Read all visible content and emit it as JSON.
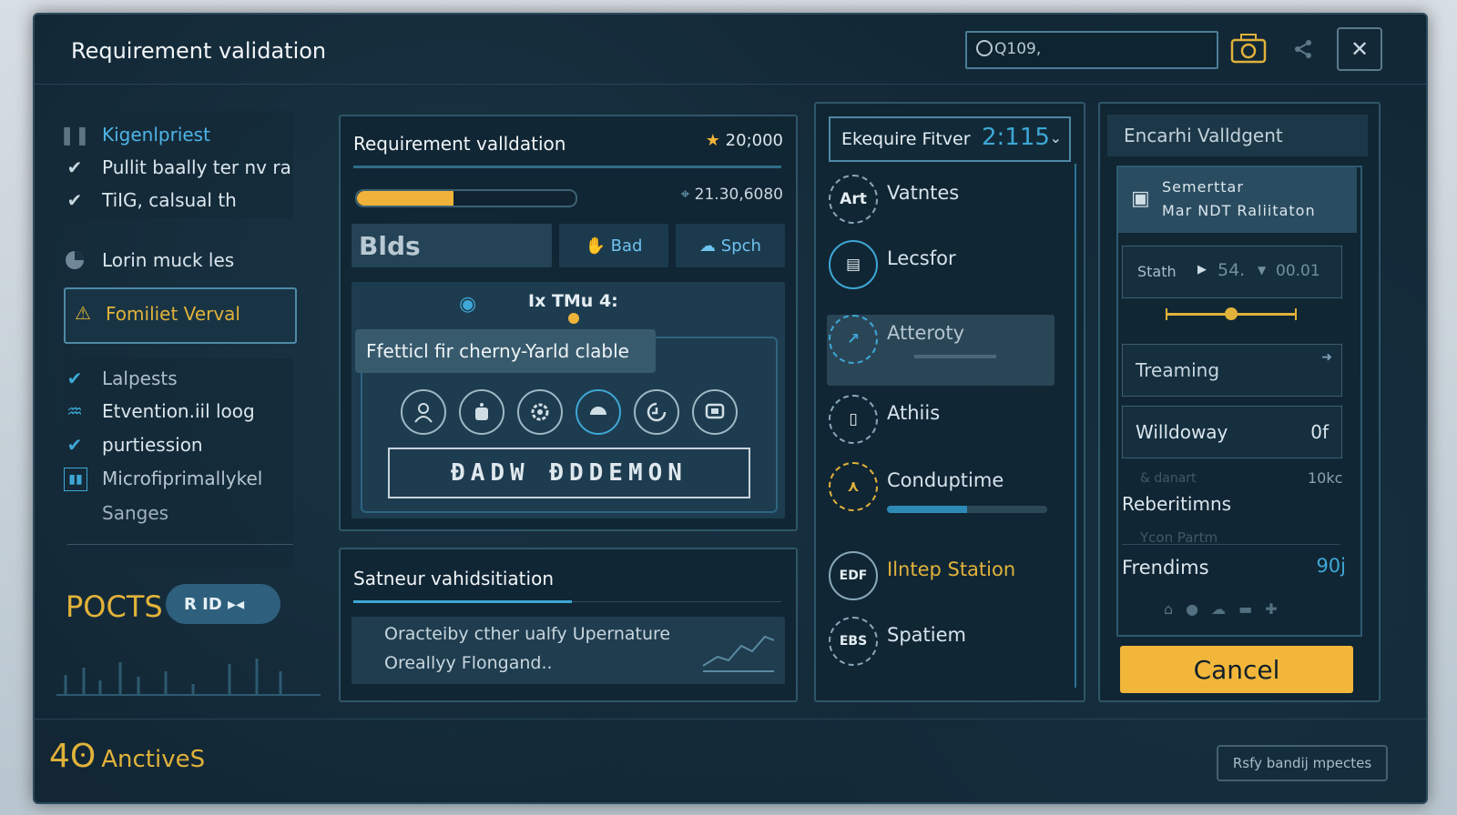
{
  "window": {
    "title": "Requirement validation"
  },
  "search": {
    "value": "Q109,"
  },
  "sidebar": {
    "group1": [
      {
        "label": "Kigenlpriest",
        "icon": "pause-icon",
        "color": "#4fb4e6"
      },
      {
        "label": "Pullit baally ter nv ra",
        "icon": "check-icon"
      },
      {
        "label": "TiIG, calsual th",
        "icon": "check-icon"
      }
    ],
    "item_lorin": "Lorin muck les",
    "active_item": "Fomiliet Verval",
    "group2": [
      {
        "label": "Lalpests",
        "icon": "check-icon"
      },
      {
        "label": "Etvention.iil loog",
        "icon": "chart-icon"
      },
      {
        "label": "purtiession",
        "icon": "check-icon"
      },
      {
        "label": "Microfiprimallykel",
        "icon": "bars-icon"
      },
      {
        "label": "Sanges",
        "icon": ""
      }
    ],
    "pocts": "POCTS",
    "pill_label": "R ID ▸◂"
  },
  "panel_main": {
    "title": "Requirement valldation",
    "star_value": "20;000",
    "progress": 0.44,
    "metric": "21.30,6080",
    "tabs": {
      "blds": "Blds",
      "bad": "Bad",
      "spch": "Spch"
    },
    "inner_heading": "Ix TMu 4:",
    "tooltip": "Ffetticl fir cherny-Yarld clable",
    "badge": "ĐADW ĐDDEMON"
  },
  "panel_secondary": {
    "title": "Satneur vahidsitiation",
    "lines": [
      "Oracteiby cther ualfy Upernature",
      "Oreallyy Flongand.."
    ]
  },
  "panel_list": {
    "dropdown_label": "Ekequire Fitver",
    "dropdown_value": "2:115",
    "items": [
      {
        "label": "Vatntes",
        "icon": "Art"
      },
      {
        "label": "Lecsfor",
        "icon": "laptop"
      },
      {
        "label": "Atteroty",
        "icon": "chart",
        "active": true
      },
      {
        "label": "Athiis",
        "icon": "phone"
      },
      {
        "label": "Conduptime",
        "icon": "person",
        "progress": 0.5
      },
      {
        "label": "Ilntep Station",
        "icon": "EDF",
        "accent": true
      },
      {
        "label": "Spatiem",
        "icon": "EBS"
      }
    ]
  },
  "panel_right": {
    "title": "Encarhi Valldgent",
    "header_line1": "Semerttar",
    "header_line2": "Mar NDT Raliitaton",
    "stath_label": "Stath",
    "stath_val1": "54.",
    "stath_val2": "00.01",
    "slider": 0.5,
    "field1": "Treaming",
    "field2_label": "Willdoway",
    "field2_value": "0f",
    "dim1": "& danart",
    "dim1_value": "10kc",
    "rebertimns": "Reberitimns",
    "dim2": "Ycon Partm",
    "frendims": "Frendims",
    "frendims_value": "90j",
    "cancel": "Cancel"
  },
  "footer": {
    "count": "4ʘ",
    "label": "AnctiveS",
    "button": "Rsfy bandij mpectes"
  }
}
